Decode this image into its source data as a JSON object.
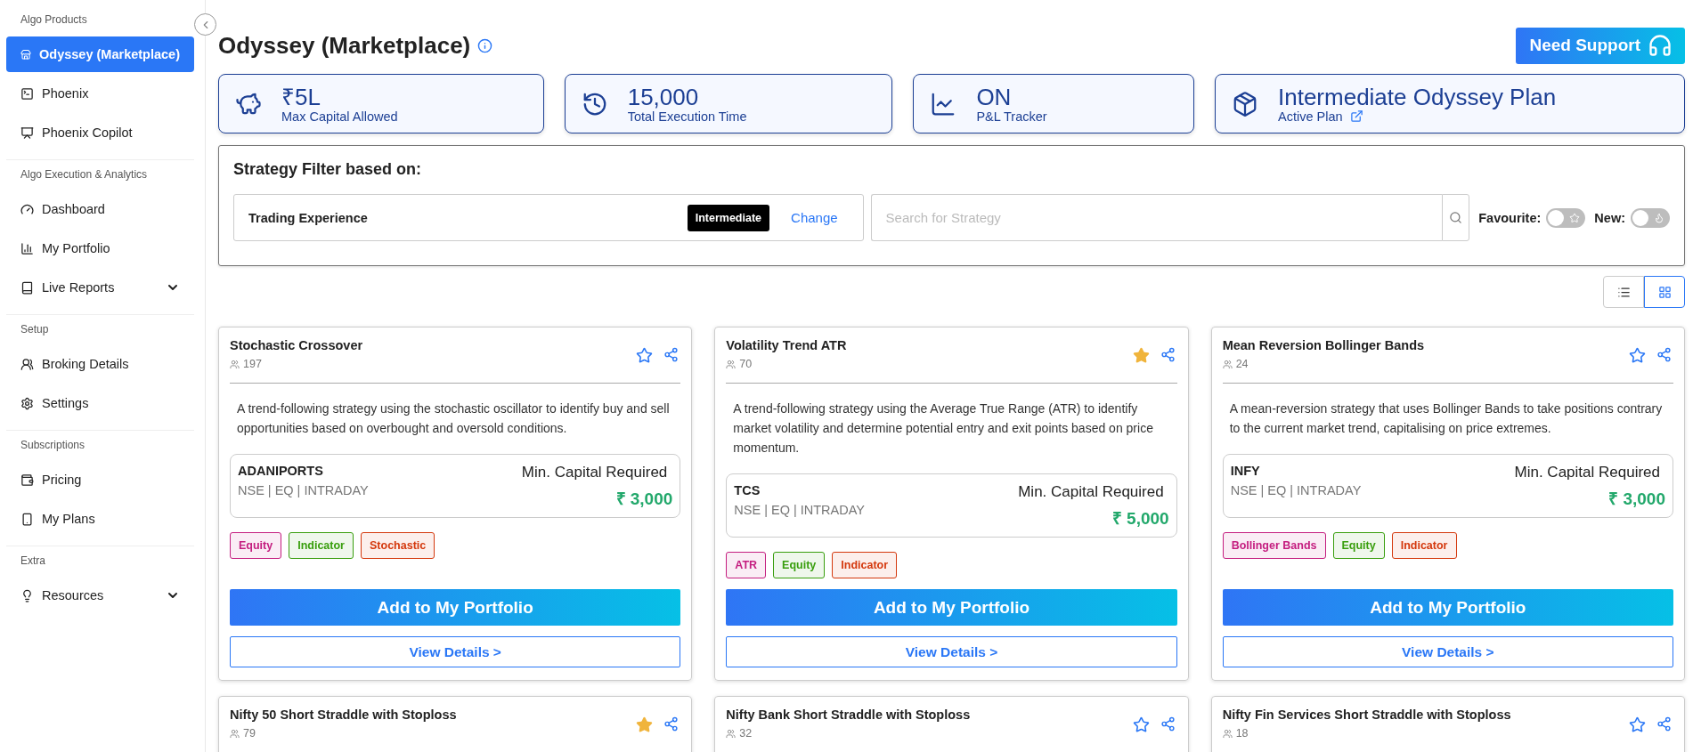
{
  "sidebar": {
    "sections": [
      {
        "label": "Algo Products",
        "items": [
          {
            "label": "Odyssey (Marketplace)",
            "selected": true,
            "expandable": false
          },
          {
            "label": "Phoenix",
            "selected": false,
            "expandable": false
          },
          {
            "label": "Phoenix Copilot",
            "selected": false,
            "expandable": false
          }
        ]
      },
      {
        "label": "Algo Execution & Analytics",
        "items": [
          {
            "label": "Dashboard",
            "selected": false,
            "expandable": false
          },
          {
            "label": "My Portfolio",
            "selected": false,
            "expandable": false
          },
          {
            "label": "Live Reports",
            "selected": false,
            "expandable": true
          }
        ]
      },
      {
        "label": "Setup",
        "items": [
          {
            "label": "Broking Details",
            "selected": false,
            "expandable": false
          },
          {
            "label": "Settings",
            "selected": false,
            "expandable": false
          }
        ]
      },
      {
        "label": "Subscriptions",
        "items": [
          {
            "label": "Pricing",
            "selected": false,
            "expandable": false
          },
          {
            "label": "My Plans",
            "selected": false,
            "expandable": false
          }
        ]
      },
      {
        "label": "Extra",
        "items": [
          {
            "label": "Resources",
            "selected": false,
            "expandable": true
          }
        ]
      }
    ]
  },
  "header": {
    "title": "Odyssey (Marketplace)",
    "support_button": "Need Support"
  },
  "stats": [
    {
      "value": "₹5L",
      "label": "Max Capital Allowed",
      "external_link": false
    },
    {
      "value": "15,000",
      "label": "Total Execution Time",
      "external_link": false
    },
    {
      "value": "ON",
      "label": "P&L Tracker",
      "external_link": false
    },
    {
      "value": "Intermediate Odyssey Plan",
      "label": "Active Plan",
      "external_link": true
    }
  ],
  "filter": {
    "title": "Strategy Filter based on:",
    "experience_label": "Trading Experience",
    "experience_value": "Intermediate",
    "change_link": "Change",
    "search_placeholder": "Search for Strategy",
    "toggles": [
      {
        "label": "Favourite:",
        "on": false
      },
      {
        "label": "New:",
        "on": false
      }
    ]
  },
  "view_toggle": [
    {
      "kind": "list",
      "selected": false
    },
    {
      "kind": "grid",
      "selected": true
    }
  ],
  "strategies": [
    {
      "title": "Stochastic Crossover",
      "users": "197",
      "favourite": false,
      "description": "A trend-following strategy using the stochastic oscillator to identify buy and sell opportunities based on overbought and oversold conditions.",
      "instrument": {
        "symbol": "ADANIPORTS",
        "segment": "NSE | EQ | INTRADAY",
        "capital_label": "Min. Capital Required",
        "capital": "₹ 3,000"
      },
      "tags": [
        {
          "label": "Equity",
          "color": "#c41d7f"
        },
        {
          "label": "Indicator",
          "color": "#389e0d"
        },
        {
          "label": "Stochastic",
          "color": "#d4380d"
        }
      ],
      "add_button": "Add to My Portfolio",
      "details_button": "View Details >"
    },
    {
      "title": "Volatility Trend ATR",
      "users": "70",
      "favourite": true,
      "description": "A trend-following strategy using the Average True Range (ATR) to identify market volatility and determine potential entry and exit points based on price momentum.",
      "instrument": {
        "symbol": "TCS",
        "segment": "NSE | EQ | INTRADAY",
        "capital_label": "Min. Capital Required",
        "capital": "₹ 5,000"
      },
      "tags": [
        {
          "label": "ATR",
          "color": "#c41d7f"
        },
        {
          "label": "Equity",
          "color": "#389e0d"
        },
        {
          "label": "Indicator",
          "color": "#d4380d"
        }
      ],
      "add_button": "Add to My Portfolio",
      "details_button": "View Details >"
    },
    {
      "title": "Mean Reversion Bollinger Bands",
      "users": "24",
      "favourite": false,
      "description": "A mean-reversion strategy that uses Bollinger Bands to take positions contrary to the current market trend, capitalising on price extremes.",
      "instrument": {
        "symbol": "INFY",
        "segment": "NSE | EQ | INTRADAY",
        "capital_label": "Min. Capital Required",
        "capital": "₹ 3,000"
      },
      "tags": [
        {
          "label": "Bollinger Bands",
          "color": "#c41d7f"
        },
        {
          "label": "Equity",
          "color": "#389e0d"
        },
        {
          "label": "Indicator",
          "color": "#d4380d"
        }
      ],
      "add_button": "Add to My Portfolio",
      "details_button": "View Details >"
    },
    {
      "title": "Nifty 50 Short Straddle with Stoploss",
      "users": "79",
      "favourite": true
    },
    {
      "title": "Nifty Bank Short Straddle with Stoploss",
      "users": "32",
      "favourite": false
    },
    {
      "title": "Nifty Fin Services Short Straddle with Stoploss",
      "users": "18",
      "favourite": false
    }
  ]
}
